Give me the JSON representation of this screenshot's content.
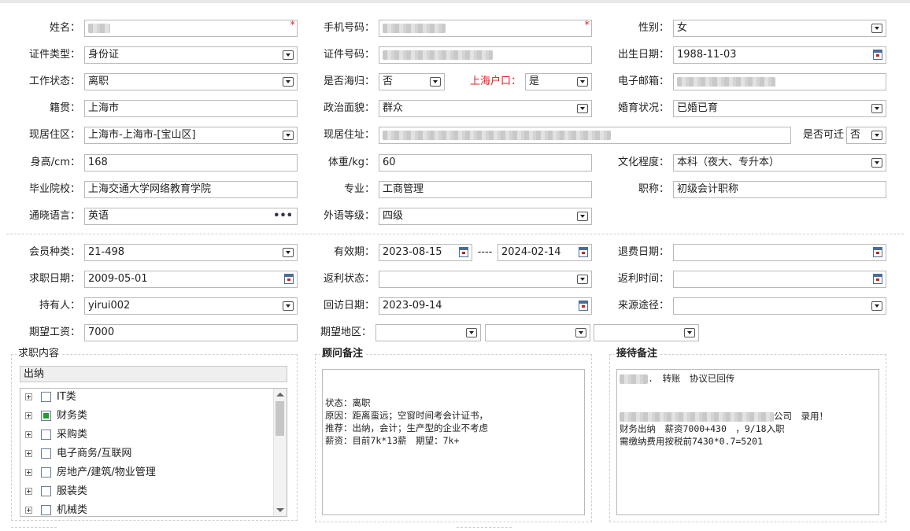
{
  "personal": {
    "name_label": "姓名：",
    "phone_label": "手机号码：",
    "gender_label": "性别：",
    "gender_value": "女",
    "id_type_label": "证件类型：",
    "id_type_value": "身份证",
    "id_no_label": "证件号码：",
    "birth_label": "出生日期：",
    "birth_value": "1988-11-03",
    "work_status_label": "工作状态：",
    "work_status_value": "离职",
    "returnee_label": "是否海归：",
    "returnee_value": "否",
    "hukou_label": "上海户口：",
    "hukou_value": "是",
    "email_label": "电子邮箱：",
    "native_label": "籍贯：",
    "native_value": "上海市",
    "political_label": "政治面貌：",
    "political_value": "群众",
    "marital_label": "婚育状况：",
    "marital_value": "已婚已育",
    "district_label": "现居住区：",
    "district_value": "上海市-上海市-[宝山区]",
    "address_label": "现居住址：",
    "relocate_label": "是否可迁",
    "relocate_value": "否",
    "height_label": "身高/cm：",
    "height_value": "168",
    "weight_label": "体重/kg：",
    "weight_value": "60",
    "education_label": "文化程度：",
    "education_value": "本科（夜大、专升本）",
    "school_label": "毕业院校：",
    "school_value": "上海交通大学网络教育学院",
    "major_label": "专业：",
    "major_value": "工商管理",
    "title_label": "职称：",
    "title_value": "初级会计职称",
    "language_label": "通晓语言：",
    "language_value": "英语",
    "language_more": "•••",
    "foreign_level_label": "外语等级：",
    "foreign_level_value": "四级"
  },
  "member": {
    "type_label": "会员种类：",
    "type_value": "21-498",
    "valid_label": "有效期：",
    "valid_from": "2023-08-15",
    "valid_sep": "----",
    "valid_to": "2024-02-14",
    "refund_date_label": "退费日期：",
    "job_date_label": "求职日期：",
    "job_date_value": "2009-05-01",
    "rebate_status_label": "返利状态：",
    "rebate_time_label": "返利时间：",
    "holder_label": "持有人：",
    "holder_value": "yirui002",
    "visit_label": "回访日期：",
    "visit_value": "2023-09-14",
    "source_label": "来源途径：",
    "salary_label": "期望工资：",
    "salary_value": "7000",
    "area_label": "期望地区："
  },
  "job_content": {
    "legend": "求职内容",
    "selected": "出纳",
    "tree": [
      {
        "label": "IT类",
        "checked": false
      },
      {
        "label": "财务类",
        "checked": true
      },
      {
        "label": "采购类",
        "checked": false
      },
      {
        "label": "电子商务/互联网",
        "checked": false
      },
      {
        "label": "房地产/建筑/物业管理",
        "checked": false
      },
      {
        "label": "服装类",
        "checked": false
      },
      {
        "label": "机械类",
        "checked": false
      }
    ]
  },
  "advisor_notes": {
    "legend": "顾问备注",
    "lines": [
      "状态：离职",
      "原因：距离蛮远；空窗时间考会计证书，",
      "推荐：出纳，会计；生产型的企业不考虑",
      "薪资：目前7k*13薪　期望：7k+"
    ]
  },
  "reception_notes": {
    "legend": "接待备注",
    "line1_tail": "转账　协议已回传",
    "line2_tail": "公司　录用！",
    "line3": "财务出纳　薪资7000+430　，9/18入职",
    "line4": "需缴纳费用按税前7430*0.7=5201"
  },
  "colors": {
    "border": "#b9b9b9",
    "required": "#e02020",
    "checkbox_on": "#1fa02a"
  }
}
